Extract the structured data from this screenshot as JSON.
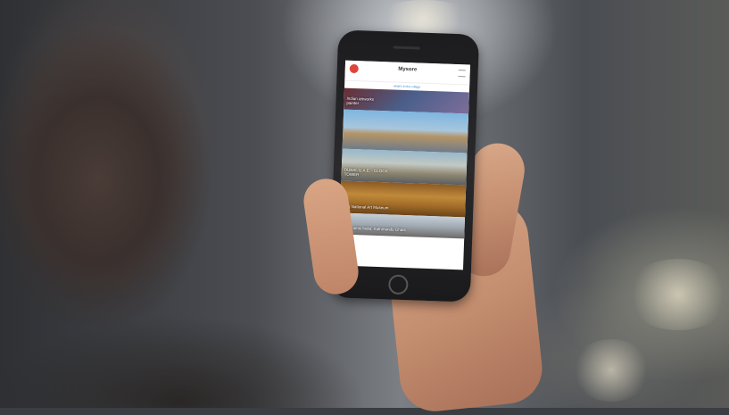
{
  "scene": {
    "description_hidden": ""
  },
  "app": {
    "title": "Mysore",
    "subtitle": "what's in the village",
    "cards": [
      {
        "label": "Indian artworks\npainter"
      },
      {
        "label": ""
      },
      {
        "label": ""
      },
      {
        "label": "DUBAI, U.A.E. - CLOCK\nTOWER"
      },
      {
        "label": "Burj National Art Museum"
      },
      {
        "label": "Panoramic India: Kathmandu Ghats"
      }
    ]
  },
  "colors": {
    "logo": "#e0453b",
    "link": "#3a8fcf"
  }
}
